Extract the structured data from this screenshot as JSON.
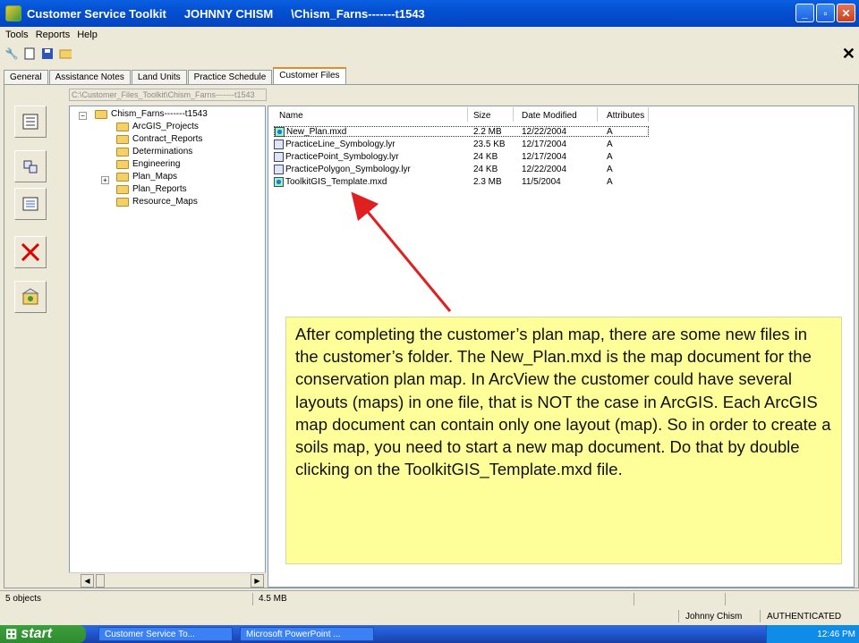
{
  "window": {
    "app_title": "Customer Service Toolkit",
    "user": "JOHNNY CHISM",
    "path_title": "\\Chism_Farns-------t1543"
  },
  "menu": [
    "Tools",
    "Reports",
    "Help"
  ],
  "tabs": [
    "General",
    "Assistance Notes",
    "Land Units",
    "Practice Schedule",
    "Customer Files"
  ],
  "active_tab": "Customer Files",
  "path": "C:\\Customer_Files_Toolkit\\Chism_Farns-------t1543",
  "tree": {
    "root": "Chism_Farns-------t1543",
    "children": [
      "ArcGIS_Projects",
      "Contract_Reports",
      "Determinations",
      "Engineering",
      "Plan_Maps",
      "Plan_Reports",
      "Resource_Maps"
    ]
  },
  "files": {
    "headers": [
      "Name",
      "Size",
      "Date Modified",
      "Attributes"
    ],
    "rows": [
      {
        "name": "New_Plan.mxd",
        "size": "2.2 MB",
        "date": "12/22/2004",
        "attr": "A"
      },
      {
        "name": "PracticeLine_Symbology.lyr",
        "size": "23.5 KB",
        "date": "12/17/2004",
        "attr": "A"
      },
      {
        "name": "PracticePoint_Symbology.lyr",
        "size": "24 KB",
        "date": "12/17/2004",
        "attr": "A"
      },
      {
        "name": "PracticePolygon_Symbology.lyr",
        "size": "24 KB",
        "date": "12/22/2004",
        "attr": "A"
      },
      {
        "name": "ToolkitGIS_Template.mxd",
        "size": "2.3 MB",
        "date": "11/5/2004",
        "attr": "A"
      }
    ]
  },
  "callout": "After completing the customer’s plan map, there are some new files in the customer’s folder. The New_Plan.mxd is the map document for the conservation plan map. In ArcView the customer could have several layouts (maps) in one file, that is NOT the case in ArcGIS. Each ArcGIS map document can contain only one layout (map). So in order to create a soils map, you need to start a new map document. Do that by double clicking on the ToolkitGIS_Template.mxd file.",
  "status": {
    "objects": "5 objects",
    "size": "4.5 MB",
    "user": "Johnny Chism",
    "auth": "AUTHENTICATED"
  },
  "taskbar": {
    "start": "start",
    "tasks": [
      "Customer Service To...",
      "Microsoft PowerPoint ..."
    ],
    "time": "12:46 PM"
  },
  "colors": {
    "callout_bg": "#ffff99",
    "arrow": "#e02020"
  }
}
